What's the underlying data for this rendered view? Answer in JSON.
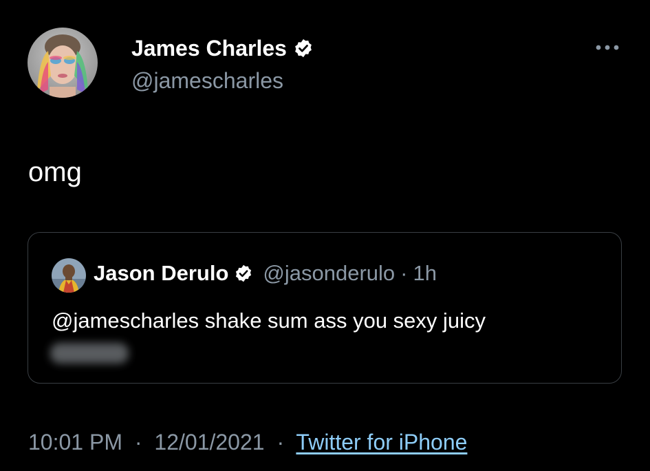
{
  "tweet": {
    "author": {
      "name": "James Charles",
      "handle": "@jamescharles",
      "verified": true,
      "avatar": "profile-photo-colorful-makeup"
    },
    "text": "omg",
    "more_icon": "more-options-icon"
  },
  "quote": {
    "author": {
      "name": "Jason Derulo",
      "handle": "@jasonderulo",
      "verified": true,
      "avatar": "profile-photo"
    },
    "separator": "·",
    "time": "1h",
    "text": "@jamescharles shake sum ass you sexy juicy",
    "blurred_text_present": true
  },
  "meta": {
    "time": "10:01 PM",
    "separator": "·",
    "date": "12/01/2021",
    "source": "Twitter for iPhone"
  },
  "colors": {
    "background": "#000000",
    "primary_text": "#ffffff",
    "secondary_text": "#8b98a5",
    "link": "#8ecdf8",
    "card_border": "#3a3f44",
    "verified_badge": "#ffffff"
  }
}
